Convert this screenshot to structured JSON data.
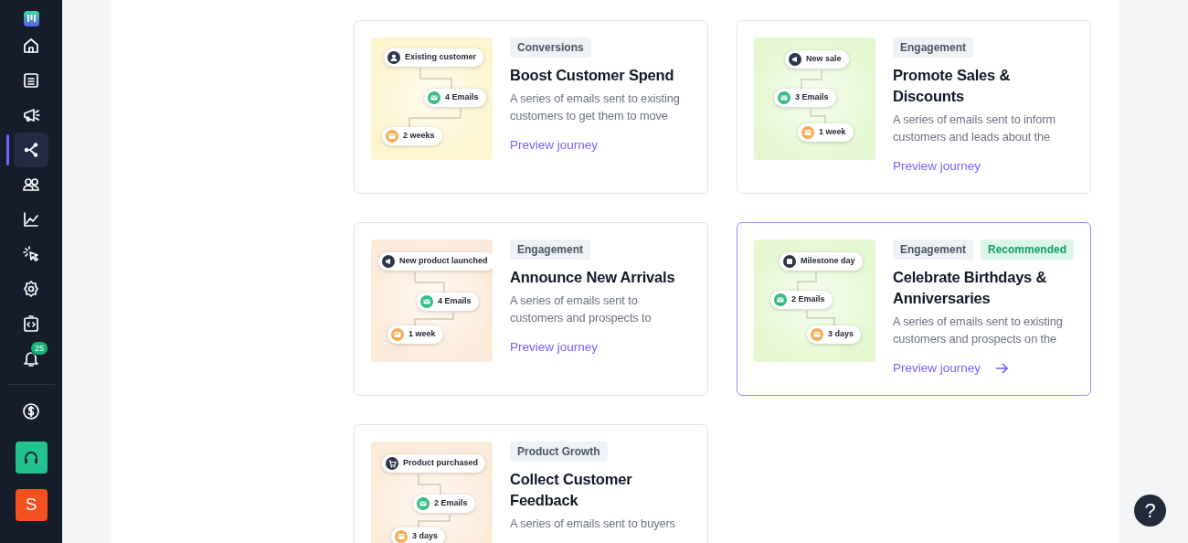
{
  "sidebar": {
    "items": [
      {
        "selected": false
      },
      {
        "selected": false
      },
      {
        "selected": false
      },
      {
        "selected": true
      },
      {
        "selected": false
      },
      {
        "selected": false
      },
      {
        "selected": false
      },
      {
        "selected": false
      },
      {
        "selected": false
      },
      {
        "selected": false,
        "badge": "25"
      }
    ],
    "footer": {
      "avatar": "S"
    }
  },
  "cards": [
    {
      "color": "#fcf5cf",
      "tags": [
        {
          "kind": "category",
          "label": "Conversions"
        }
      ],
      "title": "Boost Customer Spend",
      "description": "A series of emails sent to existing customers to get them to move",
      "link": "Preview journey",
      "highlighted": false,
      "flow": [
        {
          "kind": "trigger",
          "label": "Existing customer"
        },
        {
          "kind": "email",
          "label": "4 Emails"
        },
        {
          "kind": "wait",
          "label": "2 weeks"
        }
      ]
    },
    {
      "color": "#e5f8d2",
      "tags": [
        {
          "kind": "category",
          "label": "Engagement"
        }
      ],
      "title": "Promote Sales & Discounts",
      "description": "A series of emails sent to inform customers and leads about the",
      "link": "Preview journey",
      "highlighted": false,
      "flow": [
        {
          "kind": "trigger",
          "label": "New sale"
        },
        {
          "kind": "email",
          "label": "3 Emails"
        },
        {
          "kind": "wait",
          "label": "1 week"
        }
      ]
    },
    {
      "color": "#fcebda",
      "tags": [
        {
          "kind": "category",
          "label": "Engagement"
        }
      ],
      "title": "Announce New Arrivals",
      "description": "A series of emails sent to customers and prospects to",
      "link": "Preview journey",
      "highlighted": false,
      "flow": [
        {
          "kind": "trigger",
          "label": "New product launched"
        },
        {
          "kind": "email",
          "label": "4 Emails"
        },
        {
          "kind": "wait",
          "label": "1 week"
        }
      ]
    },
    {
      "color": "#e5f8d2",
      "tags": [
        {
          "kind": "category",
          "label": "Engagement"
        },
        {
          "kind": "recommended",
          "label": "Recommended"
        }
      ],
      "title": "Celebrate Birthdays & Anniversaries",
      "description": "A series of emails sent to existing customers and prospects on the",
      "link": "Preview journey",
      "highlighted": true,
      "flow": [
        {
          "kind": "trigger",
          "label": "Milestone day"
        },
        {
          "kind": "email",
          "label": "2 Emails"
        },
        {
          "kind": "wait",
          "label": "3 days"
        }
      ]
    },
    {
      "color": "#fcebda",
      "tags": [
        {
          "kind": "category",
          "label": "Product Growth"
        }
      ],
      "title": "Collect Customer Feedback",
      "description": "A series of emails sent to buyers",
      "highlighted": false,
      "flow": [
        {
          "kind": "trigger",
          "label": "Product purchased"
        },
        {
          "kind": "email",
          "label": "2 Emails"
        },
        {
          "kind": "wait",
          "label": "3 days"
        }
      ]
    }
  ],
  "help": {
    "label": "?"
  }
}
